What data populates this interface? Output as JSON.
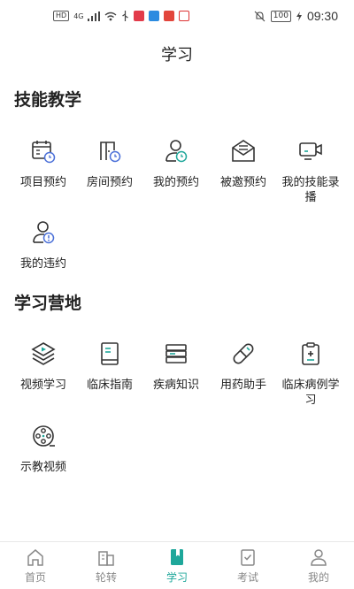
{
  "status_bar": {
    "time": "09:30",
    "battery": "100",
    "hd": "HD",
    "network": "4G"
  },
  "page": {
    "title": "学习"
  },
  "sections": [
    {
      "title": "技能教学",
      "items": [
        {
          "label": "项目预约",
          "icon": "calendar-clock-icon"
        },
        {
          "label": "房间预约",
          "icon": "room-clock-icon"
        },
        {
          "label": "我的预约",
          "icon": "user-clock-icon"
        },
        {
          "label": "被邀预约",
          "icon": "mail-open-icon"
        },
        {
          "label": "我的技能录播",
          "icon": "monitor-camera-icon"
        },
        {
          "label": "我的违约",
          "icon": "user-alert-icon"
        }
      ]
    },
    {
      "title": "学习营地",
      "items": [
        {
          "label": "视频学习",
          "icon": "layers-play-icon"
        },
        {
          "label": "临床指南",
          "icon": "book-icon"
        },
        {
          "label": "疾病知识",
          "icon": "books-stack-icon"
        },
        {
          "label": "用药助手",
          "icon": "pill-icon"
        },
        {
          "label": "临床病例学习",
          "icon": "clipboard-plus-icon"
        },
        {
          "label": "示教视频",
          "icon": "film-reel-icon"
        }
      ]
    }
  ],
  "tabbar": [
    {
      "label": "首页",
      "icon": "home-icon",
      "active": false
    },
    {
      "label": "轮转",
      "icon": "building-icon",
      "active": false
    },
    {
      "label": "学习",
      "icon": "bookmark-book-icon",
      "active": true
    },
    {
      "label": "考试",
      "icon": "checklist-icon",
      "active": false
    },
    {
      "label": "我的",
      "icon": "person-icon",
      "active": false
    }
  ],
  "colors": {
    "accent": "#1ea79a",
    "icon_stroke": "#333333",
    "icon_blue": "#4a6fd8",
    "inactive": "#888888"
  }
}
